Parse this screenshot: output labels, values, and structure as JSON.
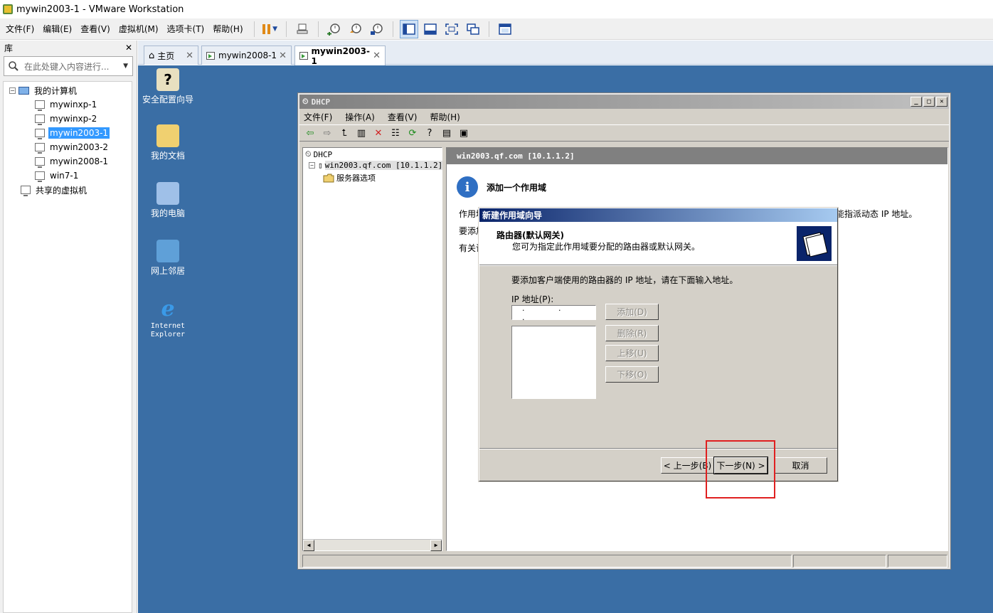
{
  "app": {
    "title": "mywin2003-1 - VMware Workstation",
    "menu": [
      "文件(F)",
      "编辑(E)",
      "查看(V)",
      "虚拟机(M)",
      "选项卡(T)",
      "帮助(H)"
    ]
  },
  "library": {
    "header": "库",
    "search_placeholder": "在此处键入内容进行...",
    "root": "我的计算机",
    "vms": [
      "mywinxp-1",
      "mywinxp-2",
      "mywin2003-1",
      "mywin2003-2",
      "mywin2008-1",
      "win7-1"
    ],
    "selected_vm": "mywin2003-1",
    "shared": "共享的虚拟机"
  },
  "tabs": [
    {
      "label": "主页"
    },
    {
      "label": "mywin2008-1"
    },
    {
      "label": "mywin2003-1",
      "active": true
    }
  ],
  "desktop": {
    "icons": [
      "安全配置向导",
      "我的文档",
      "我的电脑",
      "网上邻居",
      "Internet\nExplorer"
    ]
  },
  "dhcp_window": {
    "title": "DHCP",
    "menu": [
      "文件(F)",
      "操作(A)",
      "查看(V)",
      "帮助(H)"
    ],
    "tree_root": "DHCP",
    "tree_server": "win2003.qf.com [10.1.1.2]",
    "tree_child": "服务器选项",
    "pane_header": "win2003.qf.com [10.1.1.2]",
    "heading": "添加一个作用域",
    "line1_prefix": "作用域",
    "line1_suffix": "能指派动态 IP 地址。",
    "line2_prefix": "要添加",
    "line3_prefix": "有关详"
  },
  "wizard": {
    "title": "新建作用域向导",
    "section_title": "路由器(默认网关)",
    "section_desc": "您可为指定此作用域要分配的路由器或默认网关。",
    "instruction": "要添加客户端使用的路由器的 IP 地址，请在下面输入地址。",
    "ip_label": "IP 地址(P):",
    "ip_value": ". . .",
    "buttons": {
      "add": "添加(D)",
      "remove": "删除(R)",
      "up": "上移(U)",
      "down": "下移(O)"
    },
    "footer": {
      "back": "< 上一步(B)",
      "next": "下一步(N) >",
      "cancel": "取消"
    }
  },
  "colors": {
    "desktop": "#3a6ea5",
    "highlight": "#e02020",
    "selection": "#3399ff"
  }
}
